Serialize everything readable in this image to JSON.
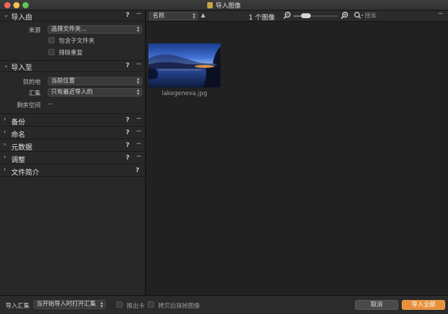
{
  "window": {
    "title": "导入图像"
  },
  "import_from": {
    "title": "导入由",
    "source_label": "来源",
    "source_value": "选择文件夹...",
    "include_subfolders": "包含子文件夹",
    "exclude_duplicates": "排除重复"
  },
  "import_to": {
    "title": "导入至",
    "destination_label": "目的地",
    "destination_value": "当前位置",
    "collection_label": "汇集",
    "collection_value": "只有最近导入的",
    "free_space_label": "剩余空间",
    "free_space_value": "--"
  },
  "sections": [
    {
      "title": "备份",
      "has_menu": true
    },
    {
      "title": "命名",
      "has_menu": true
    },
    {
      "title": "元数据",
      "has_menu": true
    },
    {
      "title": "调整",
      "has_menu": true
    },
    {
      "title": "文件简介",
      "has_menu": false
    }
  ],
  "common": {
    "help": "?",
    "menu": "···",
    "collapsed_chevron": "›",
    "expanded_chevron": "⌄"
  },
  "toolbar": {
    "sort_value": "名称",
    "sort_direction": "▲",
    "image_count": "1 个图像",
    "zoom_level": 0.2,
    "search_placeholder": "搜索",
    "menu": "···"
  },
  "images": [
    {
      "filename": "lakegeneva.jpg"
    }
  ],
  "bottom": {
    "import_collection_label": "导入汇集",
    "import_collection_value": "当开始导入时打开汇集",
    "eject_card": "推出卡",
    "erase_after_copy": "拷贝后抹掉图像",
    "cancel": "取消",
    "import_all": "导入全部"
  },
  "colors": {
    "accent": "#e8913a",
    "panel": "#282828",
    "background": "#212121"
  }
}
